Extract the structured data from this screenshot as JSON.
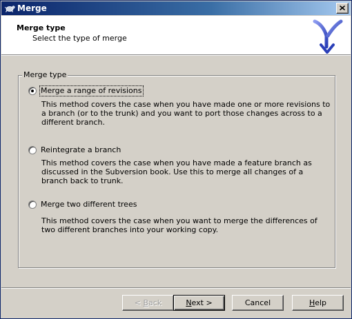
{
  "window": {
    "title": "Merge",
    "close_symbol": "×"
  },
  "header": {
    "title": "Merge type",
    "subtitle": "Select the type of merge",
    "logo_icon": "merge-arrows-icon"
  },
  "group": {
    "label": "Merge type",
    "options": [
      {
        "label": "Merge a range of revisions",
        "selected": true,
        "description": "This method covers the case when you have made one or more revisions to a branch (or to the trunk) and you want to port those changes across to a different branch."
      },
      {
        "label": "Reintegrate a branch",
        "selected": false,
        "description": "This method covers the case when you have made a feature branch as discussed in the Subversion book. Use this to merge all changes of a branch back to trunk."
      },
      {
        "label": "Merge two different trees",
        "selected": false,
        "description": "This method covers the case when you want to merge the differences of two different branches into your working copy."
      }
    ]
  },
  "buttons": {
    "back": {
      "mnemonic": "B",
      "rest": "ack",
      "prefix": "< ",
      "enabled": false
    },
    "next": {
      "mnemonic": "N",
      "rest": "ext >",
      "enabled": true,
      "default": true
    },
    "cancel": {
      "label": "Cancel",
      "enabled": true
    },
    "help": {
      "mnemonic": "H",
      "rest": "elp",
      "enabled": true
    }
  },
  "colors": {
    "titlebar_start": "#0a246a",
    "titlebar_end": "#a6caf0",
    "dialog_bg": "#d4d0c8",
    "logo_blue": "#3b4fc4"
  }
}
